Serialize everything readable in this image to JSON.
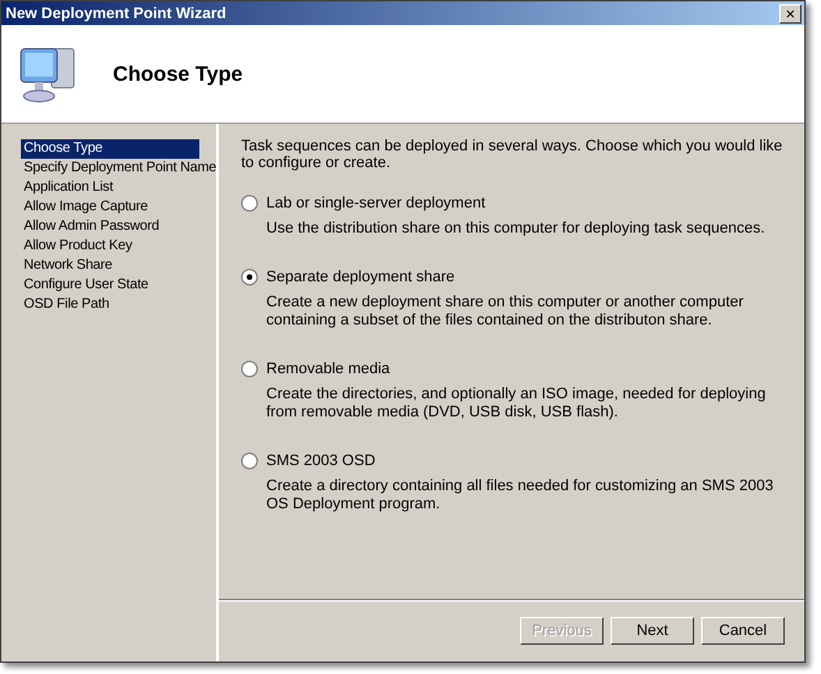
{
  "window": {
    "title": "New Deployment Point Wizard",
    "close": "×"
  },
  "header": {
    "title": "Choose Type"
  },
  "sidebar": {
    "items": [
      {
        "label": "Choose Type",
        "selected": true
      },
      {
        "label": "Specify Deployment Point Name",
        "selected": false
      },
      {
        "label": "Application List",
        "selected": false
      },
      {
        "label": "Allow Image Capture",
        "selected": false
      },
      {
        "label": "Allow Admin Password",
        "selected": false
      },
      {
        "label": "Allow Product Key",
        "selected": false
      },
      {
        "label": "Network Share",
        "selected": false
      },
      {
        "label": "Configure User State",
        "selected": false
      },
      {
        "label": "OSD File Path",
        "selected": false
      }
    ]
  },
  "intro": "Task sequences can be deployed in several ways.  Choose which you would like to configure or create.",
  "options": [
    {
      "label": "Lab or single-server deployment",
      "description": "Use the distribution share on this computer for deploying task sequences.",
      "selected": false
    },
    {
      "label": "Separate deployment share",
      "description": "Create a new deployment share on this computer or another computer containing a subset of the files contained on the distributon share.",
      "selected": true
    },
    {
      "label": "Removable media",
      "description": "Create the directories, and optionally an ISO image, needed for deploying from removable media (DVD, USB disk, USB flash).",
      "selected": false
    },
    {
      "label": "SMS 2003 OSD",
      "description": "Create a directory containing all files needed for customizing an SMS 2003 OS Deployment program.",
      "selected": false
    }
  ],
  "buttons": [
    {
      "label": "Previous",
      "disabled": true
    },
    {
      "label": "Next",
      "disabled": false
    },
    {
      "label": "Cancel",
      "disabled": false
    }
  ]
}
